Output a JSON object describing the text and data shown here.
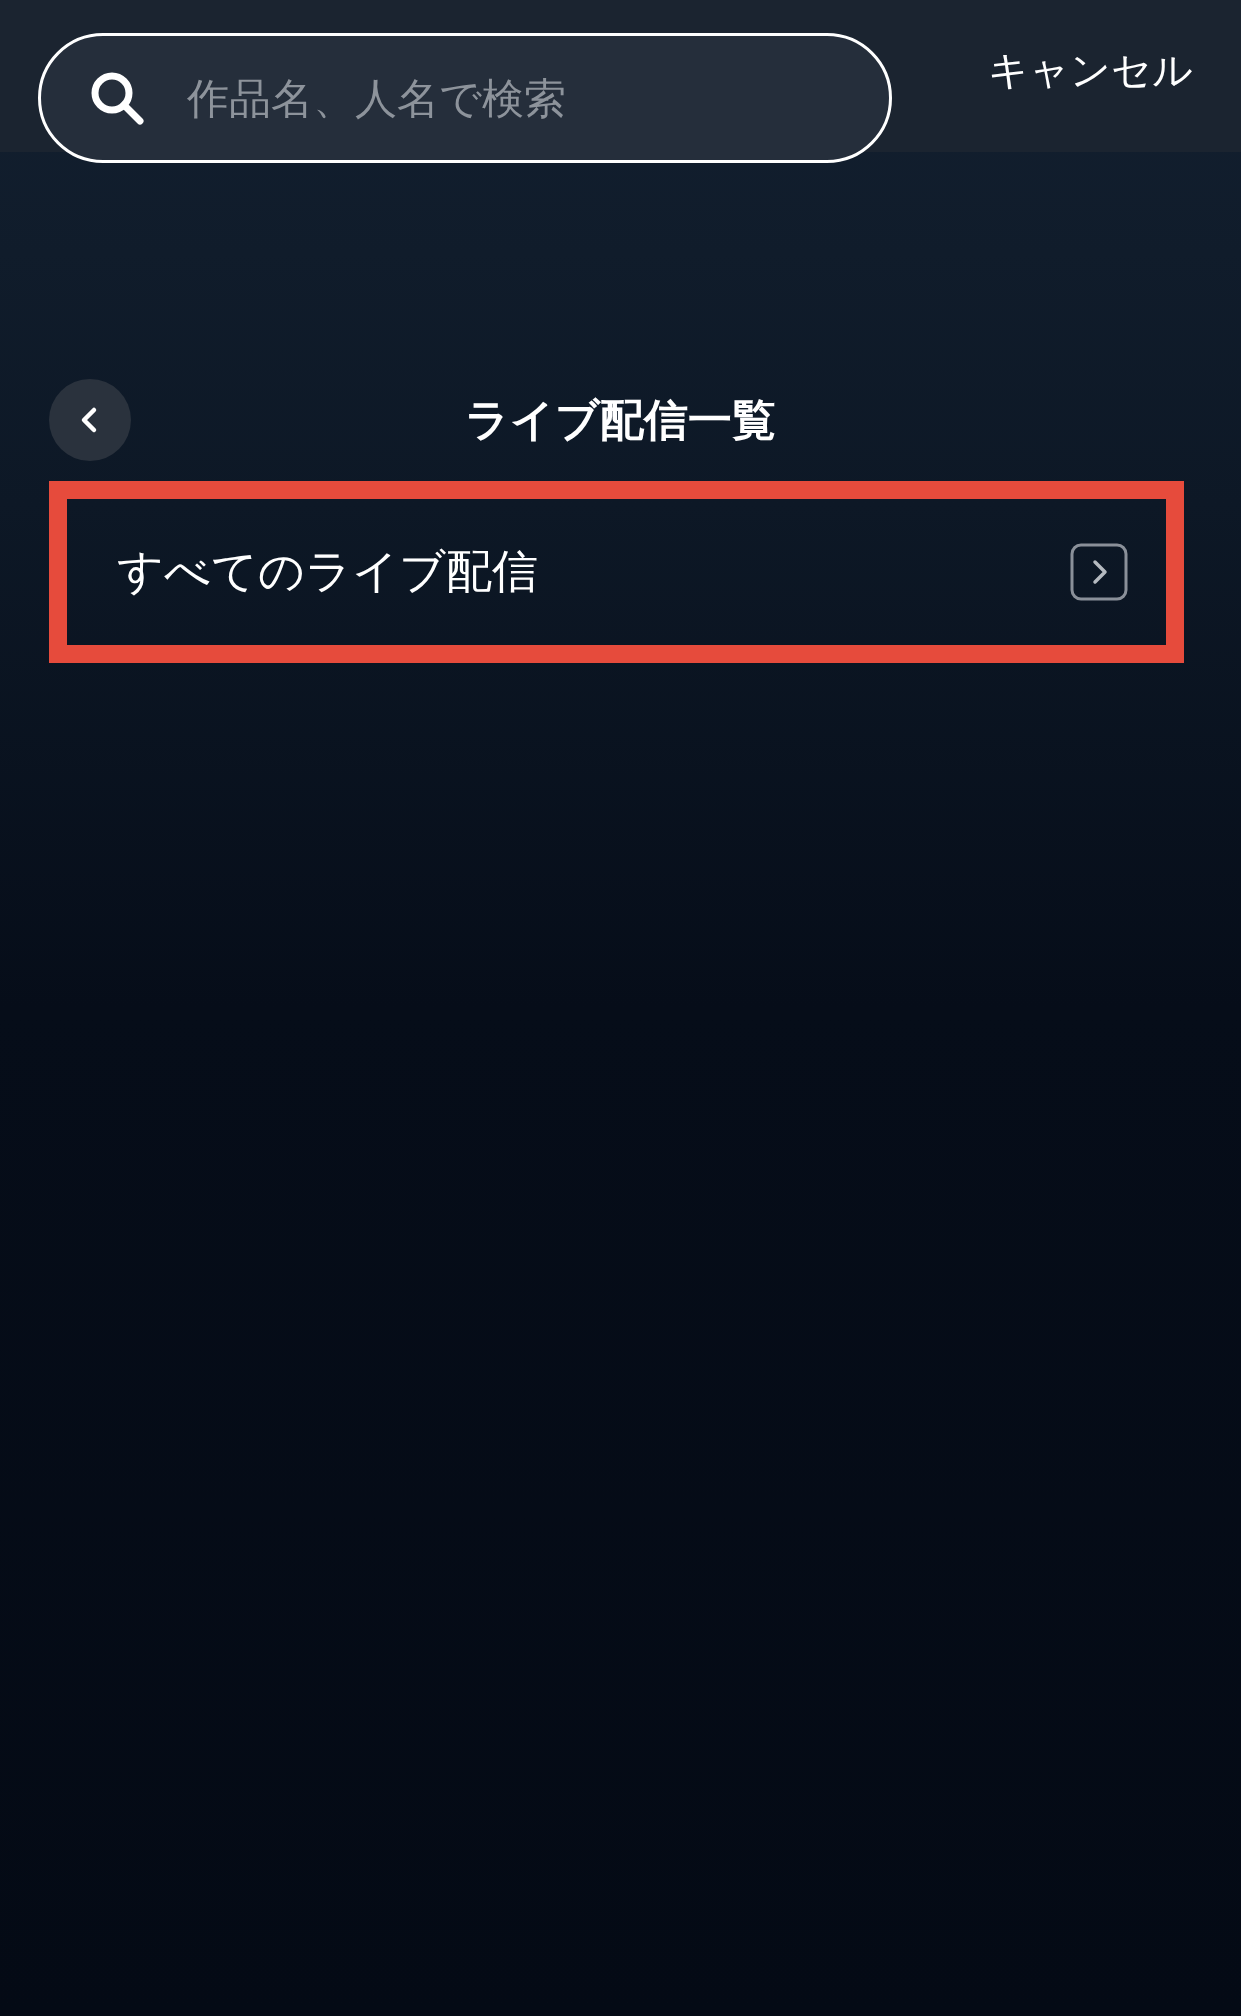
{
  "search": {
    "placeholder": "作品名、人名で検索"
  },
  "cancel": "キャンセル",
  "header": {
    "title": "ライブ配信一覧"
  },
  "items": [
    {
      "label": "すべてのライブ配信",
      "highlighted": true
    }
  ]
}
